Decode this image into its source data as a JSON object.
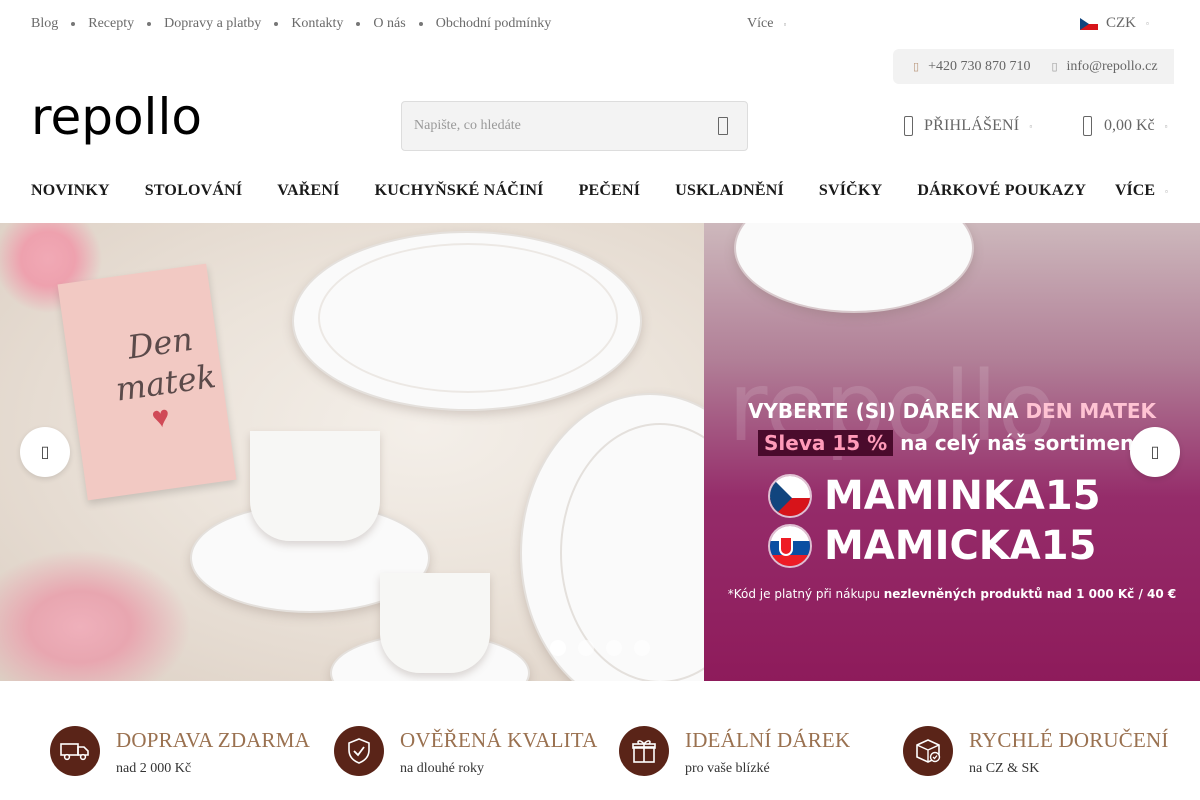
{
  "topbar": {
    "links": [
      "Blog",
      "Recepty",
      "Dopravy a platby",
      "Kontakty",
      "O nás",
      "Obchodní podmínky"
    ],
    "more": "Více",
    "currency": "CZK"
  },
  "contact": {
    "phone": "+420 730 870 710",
    "email": "info@repollo.cz"
  },
  "header": {
    "logo": "repollo",
    "search_placeholder": "Napište, co hledáte",
    "login": "PŘIHLÁŠENÍ",
    "cart_total": "0,00 Kč"
  },
  "mainnav": {
    "items": [
      "NOVINKY",
      "STOLOVÁNÍ",
      "VAŘENÍ",
      "KUCHYŇSKÉ NÁČINÍ",
      "PEČENÍ",
      "USKLADNĚNÍ",
      "SVÍČKY",
      "DÁRKOVÉ POUKAZY"
    ],
    "more": "VÍCE"
  },
  "hero": {
    "card_text_1": "Den",
    "card_text_2": "matek",
    "watermark": "repollo",
    "title_prefix": "VYBERTE (SI) DÁREK NA ",
    "title_highlight": "DEN MATEK",
    "sub_box": "Sleva 15 %",
    "sub_rest": " na celý náš sortiment",
    "code_cz": "MAMINKA15",
    "code_sk": "MAMICKA15",
    "note_prefix": "*Kód je platný při nákupu ",
    "note_bold": "nezlevněných produktů nad 1 000 Kč / 40 €",
    "slides": 4,
    "active_slide": 1
  },
  "benefits": [
    {
      "title": "DOPRAVA ZDARMA",
      "sub": "nad 2 000 Kč",
      "icon": "truck-icon"
    },
    {
      "title": "OVĚŘENÁ KVALITA",
      "sub": "na dlouhé roky",
      "icon": "shield-check-icon"
    },
    {
      "title": "IDEÁLNÍ DÁREK",
      "sub": "pro vaše blízké",
      "icon": "gift-icon"
    },
    {
      "title": "RYCHLÉ DORUČENÍ",
      "sub": "na CZ & SK",
      "icon": "package-icon"
    }
  ],
  "colors": {
    "accent_brown": "#9a7150",
    "icon_circle": "#5a2418",
    "promo_magenta": "#952c6a"
  }
}
